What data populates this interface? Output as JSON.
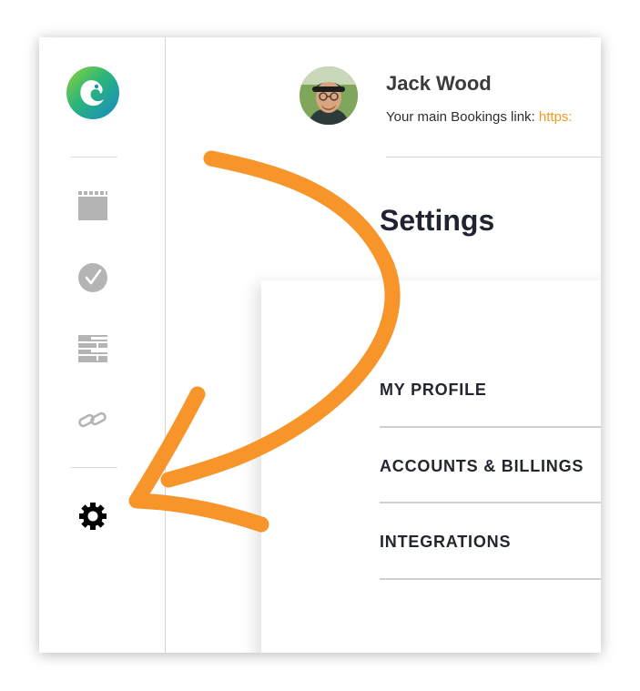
{
  "user": {
    "name": "Jack Wood",
    "booking_label": "Your main Bookings link:",
    "booking_link": "https:"
  },
  "page": {
    "title": "Settings"
  },
  "settings_menu": [
    {
      "label": "MY PROFILE"
    },
    {
      "label": "ACCOUNTS & BILLINGS"
    },
    {
      "label": "INTEGRATIONS"
    }
  ],
  "sidebar": {
    "logo_icon": "chameleon-logo-icon",
    "items": [
      {
        "icon": "calendar-icon"
      },
      {
        "icon": "checkmark-circle-icon"
      },
      {
        "icon": "list-table-icon"
      },
      {
        "icon": "link-icon"
      },
      {
        "icon": "gear-icon",
        "active": true
      }
    ]
  },
  "colors": {
    "accent": "#f39a1e",
    "arrow": "#f7942a",
    "icon_inactive": "#b4b4b4",
    "icon_active": "#000000",
    "title": "#1f2430"
  }
}
